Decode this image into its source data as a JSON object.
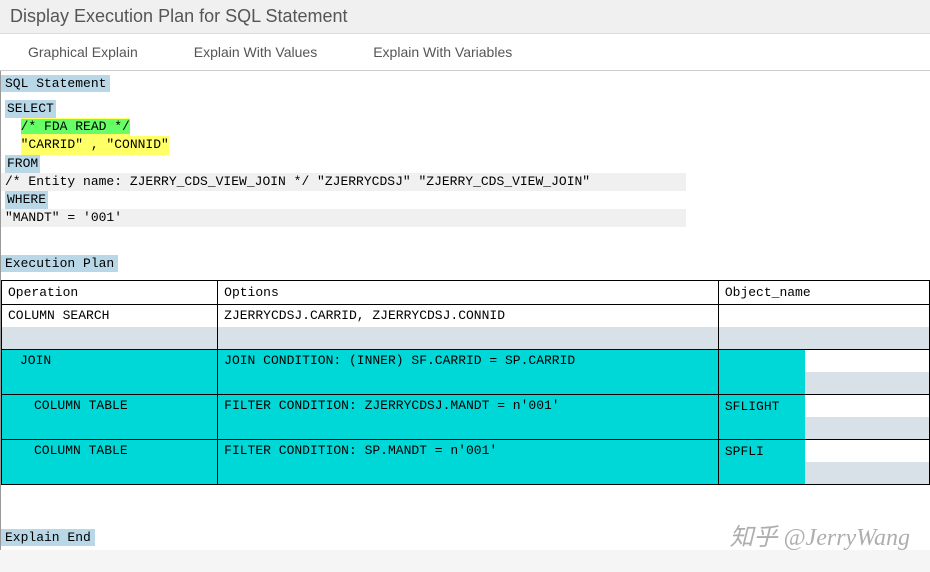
{
  "title": "Display Execution Plan for SQL Statement",
  "tabs": {
    "graphical": "Graphical Explain",
    "values": "Explain With Values",
    "variables": "Explain With Variables"
  },
  "labels": {
    "sql_statement": "SQL Statement",
    "execution_plan": "Execution Plan",
    "explain_end": "Explain End"
  },
  "sql": {
    "select": "SELECT",
    "fda_comment": "/* FDA READ */",
    "columns": "\"CARRID\" , \"CONNID\"",
    "from": "FROM",
    "entity_line": "  /* Entity name: ZJERRY_CDS_VIEW_JOIN */ \"ZJERRYCDSJ\" \"ZJERRY_CDS_VIEW_JOIN\"",
    "where": "WHERE",
    "where_cond": "  \"MANDT\" = '001'"
  },
  "plan": {
    "headers": {
      "op": "Operation",
      "opt": "Options",
      "obj": "Object_name"
    },
    "rows": [
      {
        "op": "COLUMN SEARCH",
        "opt": "ZJERRYCDSJ.CARRID, ZJERRYCDSJ.CONNID",
        "obj": "",
        "style": "plain",
        "indent": 0
      },
      {
        "op": "JOIN",
        "opt": "JOIN CONDITION: (INNER) SF.CARRID = SP.CARRID",
        "obj": "",
        "style": "teal",
        "indent": 1
      },
      {
        "op": "COLUMN TABLE",
        "opt": "FILTER CONDITION: ZJERRYCDSJ.MANDT = n'001'",
        "obj": "SFLIGHT",
        "style": "teal",
        "indent": 2
      },
      {
        "op": "COLUMN TABLE",
        "opt": "FILTER CONDITION: SP.MANDT = n'001'",
        "obj": "SPFLI",
        "style": "teal",
        "indent": 2
      }
    ]
  },
  "watermark": "知乎 @JerryWang"
}
